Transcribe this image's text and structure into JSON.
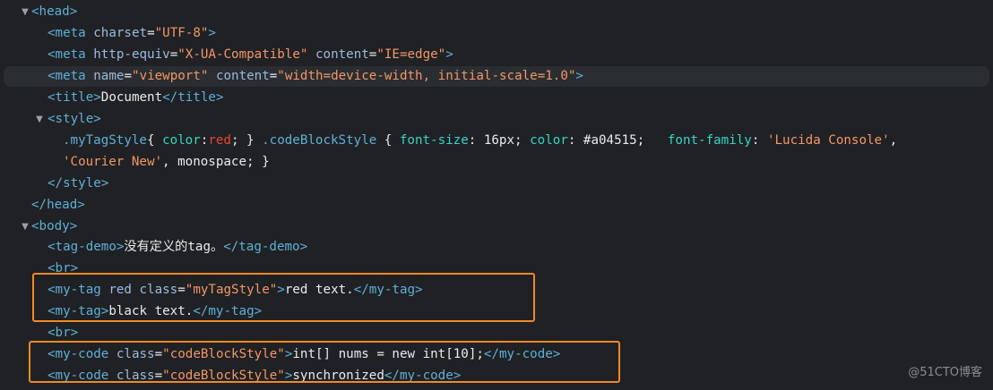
{
  "dom_tree": {
    "head_open": "<head>",
    "meta1": {
      "open": "<meta",
      "attr1": "charset",
      "val1": "\"UTF-8\"",
      "close": ">"
    },
    "meta2": {
      "open": "<meta",
      "attr1": "http-equiv",
      "val1": "\"X-UA-Compatible\"",
      "attr2": "content",
      "val2": "\"IE=edge\"",
      "close": ">"
    },
    "meta3": {
      "open": "<meta",
      "attr1": "name",
      "val1": "\"viewport\"",
      "attr2": "content",
      "val2": "\"width=device-width, initial-scale=1.0\"",
      "close": ">"
    },
    "title": {
      "open": "<title>",
      "text": "Document",
      "close": "</title>"
    },
    "style_open": "<style>",
    "css_line1": {
      "sel1": ".myTagStyle",
      "brace1": "{ ",
      "prop1": "color",
      "colon1": ":",
      "val1": "red",
      "end1": "; } ",
      "sel2": ".codeBlockStyle",
      "brace2": " { ",
      "prop2": "font-size",
      "colon2": ": ",
      "val2": "16px",
      "semi2": "; ",
      "prop3": "color",
      "colon3": ": ",
      "val3": "#a04515",
      "semi3": ";   ",
      "prop4": "font-family",
      "colon4": ": ",
      "val4": "'Lucida Console'",
      "comma4": ","
    },
    "css_line2": {
      "str": "'Courier New'",
      "rest": ", monospace; }"
    },
    "style_close": "</style>",
    "head_close": "</head>",
    "body_open": "<body>",
    "tag_demo": {
      "open": "<tag-demo>",
      "text": "没有定义的tag。",
      "close": "</tag-demo>"
    },
    "br1": "<br>",
    "my_tag_red": {
      "open": "<my-tag",
      "attr1": "red",
      "attr2": "class",
      "eq": "=",
      "val2": "\"myTagStyle\"",
      "gt": ">",
      "text": "red text.",
      "close": "</my-tag>"
    },
    "my_tag_black": {
      "open": "<my-tag>",
      "text": "black text.",
      "close": "</my-tag>"
    },
    "br2": "<br>",
    "my_code1": {
      "open": "<my-code",
      "attr": "class",
      "eq": "=",
      "val": "\"codeBlockStyle\"",
      "gt": ">",
      "text": "int[] nums = new int[10];",
      "close": "</my-code>"
    },
    "my_code2": {
      "open": "<my-code",
      "attr": "class",
      "eq": "=",
      "val": "\"codeBlockStyle\"",
      "gt": ">",
      "text": "synchronized",
      "close": "</my-code>"
    }
  },
  "watermark": "@51CTO博客",
  "colors": {
    "highlight_box": "#f08a26",
    "tag": "#5db0d7",
    "attribute_value": "#f29766",
    "background": "#202124"
  },
  "icons": [
    "caret-down-icon"
  ]
}
